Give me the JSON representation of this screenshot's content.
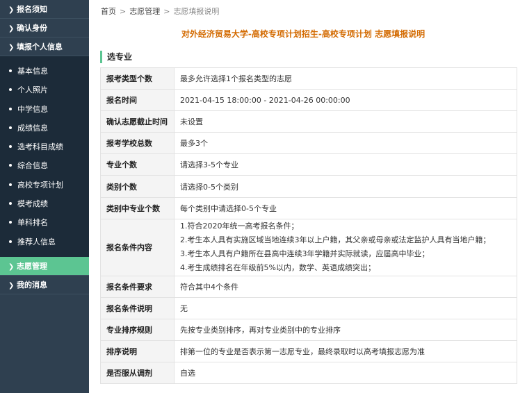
{
  "sidebar": {
    "items": [
      {
        "label": "报名须知"
      },
      {
        "label": "确认身份"
      },
      {
        "label": "填报个人信息"
      }
    ],
    "sub_items": [
      {
        "label": "基本信息"
      },
      {
        "label": "个人照片"
      },
      {
        "label": "中学信息"
      },
      {
        "label": "成绩信息"
      },
      {
        "label": "选考科目成绩"
      },
      {
        "label": "综合信息"
      },
      {
        "label": "高校专项计划"
      },
      {
        "label": "模考成绩"
      },
      {
        "label": "单科排名"
      },
      {
        "label": "推荐人信息"
      }
    ],
    "bottom_items": [
      {
        "label": "志愿管理",
        "active": true
      },
      {
        "label": "我的消息"
      }
    ],
    "accent_color": "#5cc592",
    "bg_color": "#2f4050"
  },
  "breadcrumb": {
    "home": "首页",
    "section": "志愿管理",
    "current": "志愿填报说明"
  },
  "page_title": "对外经济贸易大学-高校专项计划招生-高校专项计划 志愿填报说明",
  "section_title": "选专业",
  "rows": [
    {
      "key": "报考类型个数",
      "value": "最多允许选择1个报名类型的志愿"
    },
    {
      "key": "报名时间",
      "value": "2021-04-15 18:00:00 - 2021-04-26 00:00:00"
    },
    {
      "key": "确认志愿截止时间",
      "value": "未设置"
    },
    {
      "key": "报考学校总数",
      "value": "最多3个"
    },
    {
      "key": "专业个数",
      "value": "请选择3-5个专业"
    },
    {
      "key": "类别个数",
      "value": "请选择0-5个类别"
    },
    {
      "key": "类别中专业个数",
      "value": "每个类别中请选择0-5个专业"
    }
  ],
  "conditions": {
    "key": "报名条件内容",
    "lines": [
      "1.符合2020年统一高考报名条件；",
      "2.考生本人具有实施区域当地连续3年以上户籍，其父亲或母亲或法定监护人具有当地户籍；",
      "3.考生本人具有户籍所在县高中连续3年学籍并实际就读，应届高中毕业；",
      "4.考生成绩排名在年级前5%以内，数学、英语成绩突出；"
    ]
  },
  "rows_after": [
    {
      "key": "报名条件要求",
      "value": "符合其中4个条件"
    },
    {
      "key": "报名条件说明",
      "value": "无"
    },
    {
      "key": "专业排序规则",
      "value": "先按专业类别排序，再对专业类别中的专业排序"
    },
    {
      "key": "排序说明",
      "value": "排第一位的专业是否表示第一志愿专业，最终录取时以高考填报志愿为准"
    },
    {
      "key": "是否服从调剂",
      "value": "自选"
    }
  ],
  "title_color": "#d36a00"
}
